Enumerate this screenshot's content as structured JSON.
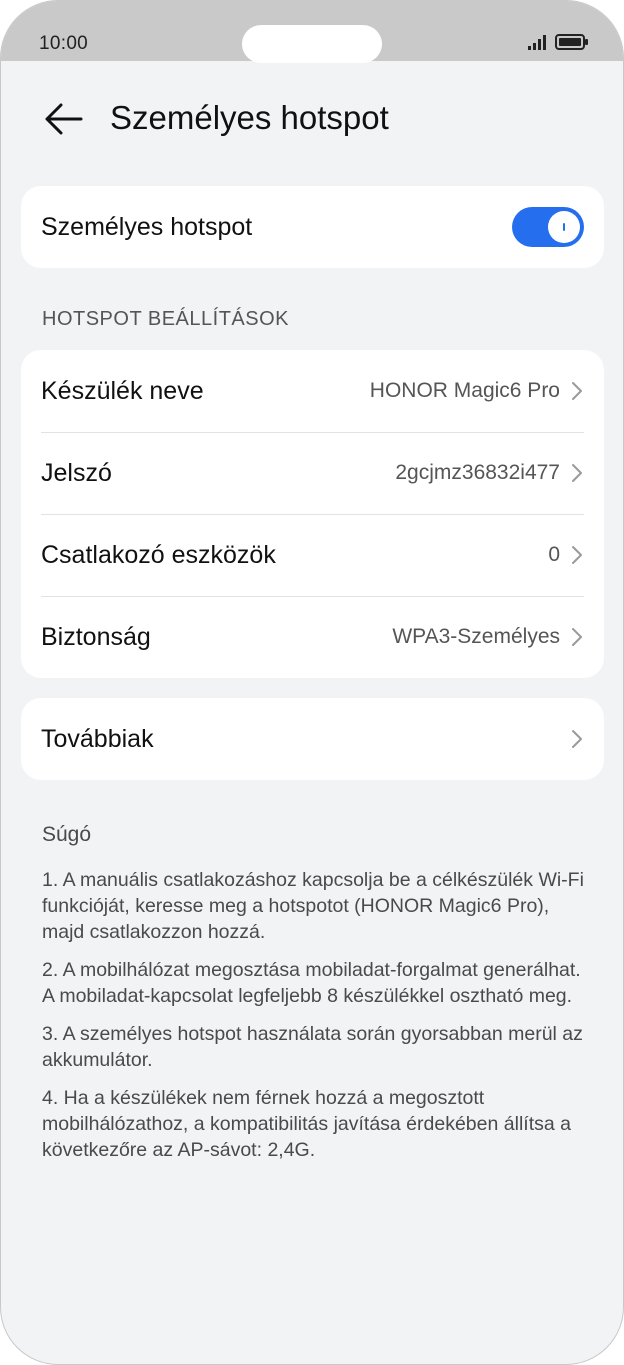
{
  "status_bar": {
    "time": "10:00"
  },
  "header": {
    "title": "Személyes hotspot"
  },
  "hotspot_toggle": {
    "label": "Személyes hotspot",
    "enabled": true,
    "color": "#256fef"
  },
  "settings_section": {
    "title": "HOTSPOT BEÁLLÍTÁSOK",
    "rows": [
      {
        "label": "Készülék neve",
        "value": "HONOR Magic6 Pro"
      },
      {
        "label": "Jelszó",
        "value": "2gcjmz36832i477"
      },
      {
        "label": "Csatlakozó eszközök",
        "value": "0"
      },
      {
        "label": "Biztonság",
        "value": "WPA3-Személyes"
      }
    ]
  },
  "more": {
    "label": "Továbbiak"
  },
  "help": {
    "title": "Súgó",
    "items": [
      "1. A manuális csatlakozáshoz kapcsolja be a célkészülék Wi-Fi funkcióját, keresse meg a hotspotot (HONOR Magic6 Pro), majd csatlakozzon hozzá.",
      "2. A mobilhálózat megosztása mobiladat-forgalmat generálhat. A mobiladat-kapcsolat legfeljebb 8 készülékkel osztható meg.",
      "3. A személyes hotspot használata során gyorsabban merül az akkumulátor.",
      "4. Ha a készülékek nem férnek hozzá a megosztott mobilhálózathoz, a kompatibilitás javítása érdekében állítsa a következőre az AP-sávot: 2,4G."
    ]
  },
  "icons": {
    "back": "arrow-left-icon",
    "chevron": "chevron-right-icon",
    "signal": "signal-icon",
    "battery": "battery-icon"
  }
}
